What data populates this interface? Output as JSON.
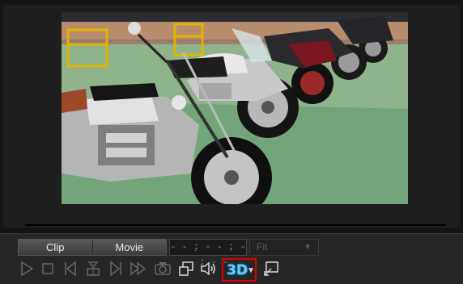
{
  "preview": {
    "scene": "Parked motorcycles at an outdoor event",
    "progress": 0
  },
  "controls": {
    "clip_label": "Clip",
    "movie_label": "Movie",
    "active_mode": "Clip",
    "timecode": "- - ; - - ; - - ; - -",
    "fit_label": "Fit",
    "toolbar_icons": [
      "play-icon",
      "stop-icon",
      "previous-frame-icon",
      "split-icon",
      "next-frame-icon",
      "fast-forward-icon",
      "snapshot-icon",
      "display-mode-icon",
      "volume-icon",
      "3d-mode-icon",
      "undock-preview-icon"
    ],
    "three_d_label": "3D"
  },
  "colors": {
    "highlight_border": "#e00000",
    "three_d_text": "#5fd0ff"
  }
}
